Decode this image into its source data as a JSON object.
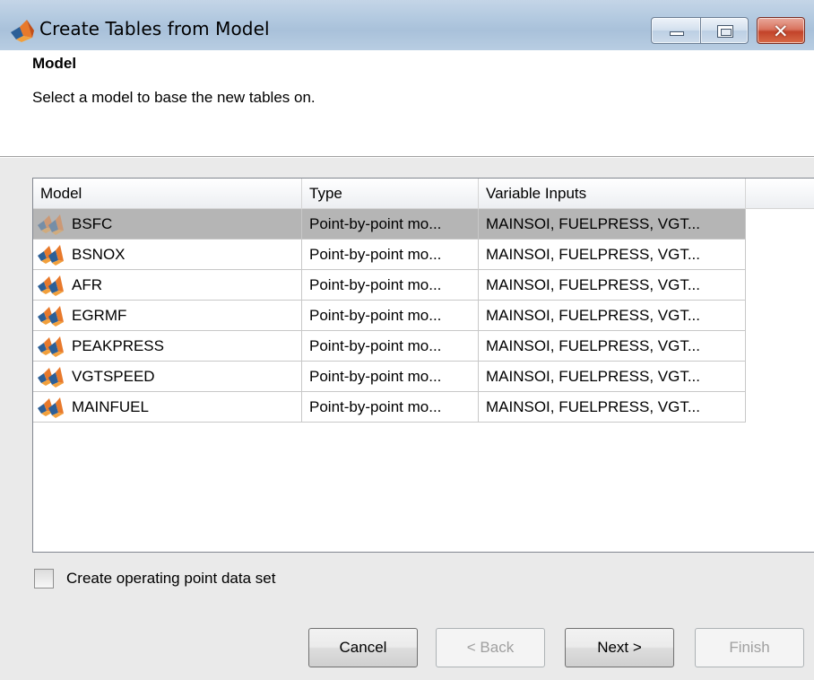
{
  "window": {
    "title": "Create Tables from Model",
    "close_glyph": "✕"
  },
  "header": {
    "title": "Model",
    "description": "Select a model to base the new tables on."
  },
  "table": {
    "columns": [
      "Model",
      "Type",
      "Variable Inputs"
    ],
    "selected_row": 0,
    "rows": [
      {
        "model": "BSFC",
        "type": "Point-by-point mo...",
        "inputs": "MAINSOI, FUELPRESS, VGT..."
      },
      {
        "model": "BSNOX",
        "type": "Point-by-point mo...",
        "inputs": "MAINSOI, FUELPRESS, VGT..."
      },
      {
        "model": "AFR",
        "type": "Point-by-point mo...",
        "inputs": "MAINSOI, FUELPRESS, VGT..."
      },
      {
        "model": "EGRMF",
        "type": "Point-by-point mo...",
        "inputs": "MAINSOI, FUELPRESS, VGT..."
      },
      {
        "model": "PEAKPRESS",
        "type": "Point-by-point mo...",
        "inputs": "MAINSOI, FUELPRESS, VGT..."
      },
      {
        "model": "VGTSPEED",
        "type": "Point-by-point mo...",
        "inputs": "MAINSOI, FUELPRESS, VGT..."
      },
      {
        "model": "MAINFUEL",
        "type": "Point-by-point mo...",
        "inputs": "MAINSOI, FUELPRESS, VGT..."
      }
    ]
  },
  "options": {
    "create_op_point_label": "Create operating point data set",
    "create_op_point_checked": false
  },
  "buttons": {
    "cancel": "Cancel",
    "back": "< Back",
    "next": "Next >",
    "finish": "Finish"
  },
  "colors": {
    "selected_row": "#b5b5b5",
    "dialog_background": "#eaeaea",
    "titlebar": "#b1c8df"
  },
  "icons": {
    "app": "matlab-logo-icon",
    "model_row": "model-icon"
  }
}
